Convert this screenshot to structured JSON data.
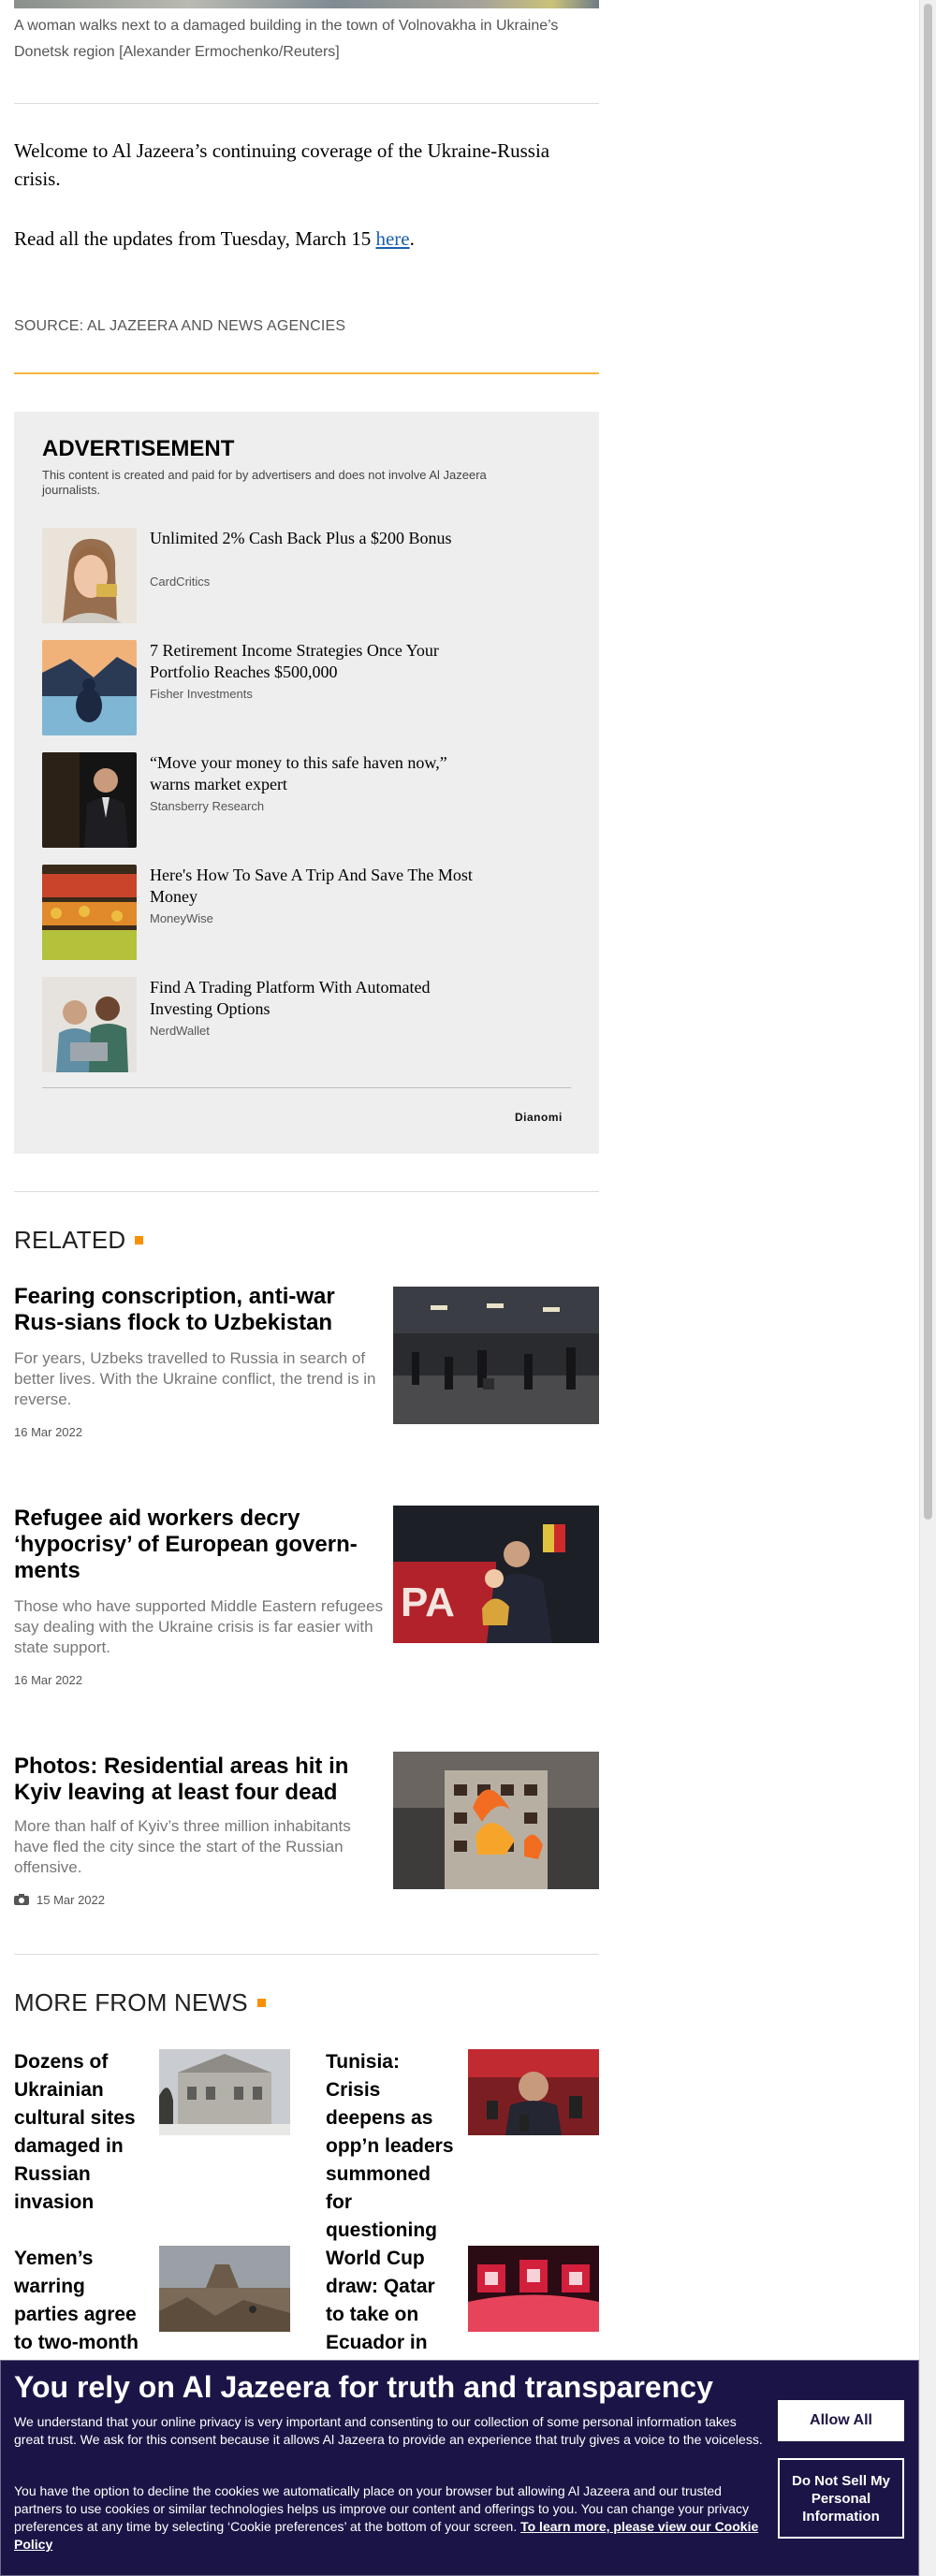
{
  "article": {
    "caption": "A woman walks next to a damaged building in the town of Volnovakha in Ukraine’s Donetsk region [Alexander Ermochenko/Reuters]",
    "lead": "Welcome to Al Jazeera’s continuing coverage of the Ukraine-Russia crisis.",
    "updates_prefix": "Read all the updates from Tuesday, March 15 ",
    "updates_link": "here",
    "updates_suffix": ".",
    "source": "SOURCE: AL JAZEERA AND NEWS AGENCIES"
  },
  "advertisement": {
    "title": "ADVERTISEMENT",
    "note": "This content is created and paid for by advertisers and does not involve Al Jazeera journalists.",
    "items": [
      {
        "headline": "Unlimited 2% Cash Back Plus a $200 Bonus",
        "source": "CardCritics"
      },
      {
        "headline": "7 Retirement Income Strategies Once Your Portfolio Reaches $500,000",
        "source": "Fisher Investments"
      },
      {
        "headline": "“Move your money to this safe haven now,” warns market expert",
        "source": "Stansberry Research"
      },
      {
        "headline": "Here's How To Save A Trip And Save The Most Money",
        "source": "MoneyWise"
      },
      {
        "headline": "Find A Trading Platform With Automated Investing Options",
        "source": "NerdWallet"
      }
    ],
    "brand": "Dianomi"
  },
  "related": {
    "title": "RELATED",
    "items": [
      {
        "headline": "Fearing conscription, anti-war Rus-sians flock to Uzbekistan",
        "summary": "For years, Uzbeks travelled to Russia in search of better lives. With the Ukraine conflict, the trend is in reverse.",
        "date": "16 Mar 2022"
      },
      {
        "headline": "Refugee aid workers decry ‘hypocrisy’ of European govern-ments",
        "summary": "Those who have supported Middle Eastern refugees say dealing with the Ukraine crisis is far easier with state support.",
        "date": "16 Mar 2022"
      },
      {
        "headline": "Photos: Residential areas hit in Kyiv leaving at least four dead",
        "summary": "More than half of Kyiv’s three million inhabitants have fled the city since the start of the Russian offensive.",
        "date": "15 Mar 2022"
      }
    ]
  },
  "more": {
    "title": "MORE FROM NEWS",
    "items": [
      {
        "headline": "Dozens of Ukrainian cultural sites damaged in Russian invasion"
      },
      {
        "headline": "Tunisia: Crisis deepens as opp’n leaders summoned for questioning"
      },
      {
        "headline": "Yemen’s warring parties agree to two-month truce,"
      },
      {
        "headline": "World Cup draw: Qatar to take on Ecuador in"
      }
    ]
  },
  "cookie": {
    "title": "You rely on Al Jazeera for truth and transparency",
    "p1": "We understand that your online privacy is very important and consenting to our collection of some personal information takes great trust. We ask for this consent because it allows Al Jazeera to provide an experience that truly gives a voice to the voiceless.",
    "p2": "You have the option to decline the cookies we automatically place on your browser but allowing Al Jazeera and our trusted partners to use cookies or similar technologies helps us improve our content and offerings to you. You can change your privacy preferences at any time by selecting ‘Cookie preferences’ at the bottom of your screen. ",
    "p2_link": "To learn more, please view our Cookie Policy",
    "allow_all": "Allow All",
    "do_not_sell": "Do Not Sell My Personal Information"
  },
  "colors": {
    "accent": "#fa9000",
    "banner": "#1b1547",
    "link": "#1b5fb0"
  },
  "icons": {
    "photo_gallery": "camera-icon"
  }
}
